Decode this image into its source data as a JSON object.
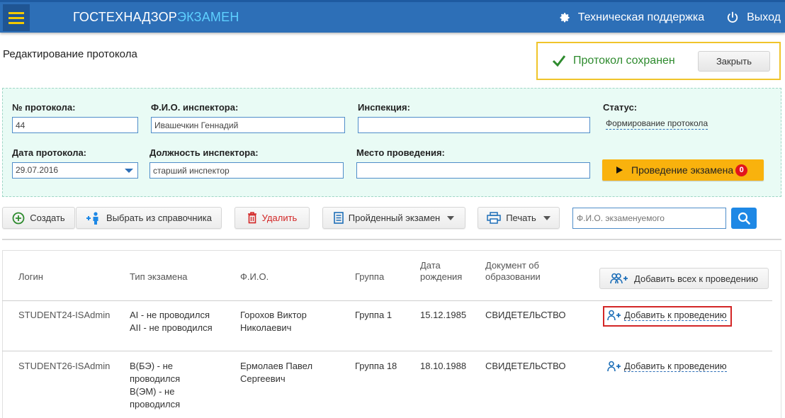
{
  "header": {
    "brand_main": "ГОСТЕХНАДЗОР",
    "brand_accent": "ЭКЗАМЕН",
    "support_label": "Техническая поддержка",
    "logout_label": "Выход"
  },
  "page": {
    "title": "Редактирование протокола"
  },
  "toast": {
    "message": "Протокол сохранен",
    "close_label": "Закрыть"
  },
  "form": {
    "protocol_no": {
      "label": "№ протокола:",
      "value": "44"
    },
    "inspector_name": {
      "label": "Ф.И.О. инспектора:",
      "value": "Ивашечкин Геннадий"
    },
    "inspection": {
      "label": "Инспекция:",
      "value": ""
    },
    "status": {
      "label": "Статус:",
      "value": "Формирование протокола"
    },
    "protocol_date": {
      "label": "Дата протокола:",
      "value": "29.07.2016"
    },
    "inspector_position": {
      "label": "Должность инспектора:",
      "value": "старший инспектор"
    },
    "venue": {
      "label": "Место проведения:",
      "value": ""
    },
    "exam_button": {
      "label": "Проведение экзамена",
      "badge": "0"
    }
  },
  "toolbar": {
    "create": "Создать",
    "choose": "Выбрать из справочника",
    "delete": "Удалить",
    "passed_exam": "Пройденный экзамен",
    "print": "Печать",
    "search_placeholder": "Ф.И.О. экзаменуемого"
  },
  "table": {
    "headers": {
      "login": "Логин",
      "exam_type": "Тип экзамена",
      "fio": "Ф.И.О.",
      "group": "Группа",
      "birth_date_1": "Дата",
      "birth_date_2": "рождения",
      "education_1": "Документ об",
      "education_2": "образовании"
    },
    "add_all_label": "Добавить всех к проведению",
    "rows": [
      {
        "login": "STUDENT24-ISAdmin",
        "exam_lines": [
          "AI - не проводился",
          "AII - не проводился"
        ],
        "fio_lines": [
          "Горохов Виктор",
          "Николаевич"
        ],
        "group": "Группа 1",
        "birth_date": "15.12.1985",
        "education": "СВИДЕТЕЛЬСТВО",
        "action": "Добавить к проведению"
      },
      {
        "login": "STUDENT26-ISAdmin",
        "exam_lines": [
          "В(БЭ) - не",
          "проводился",
          "В(ЭМ) - не",
          "проводился"
        ],
        "fio_lines": [
          "Ермолаев Павел",
          "Сергеевич"
        ],
        "group": "Группа 18",
        "birth_date": "18.10.1988",
        "education": "СВИДЕТЕЛЬСТВО",
        "action": "Добавить к проведению"
      }
    ]
  },
  "colors": {
    "header_bg": "#2d6fb7",
    "brand_accent": "#5ed0ff",
    "success": "#2e8b2e",
    "exam_button": "#f9b20d",
    "danger": "#d32626"
  },
  "icons": {
    "menu": "hamburger-icon",
    "support": "gear-icon",
    "logout": "power-icon",
    "toast": "check-icon",
    "create": "plus-circle-icon",
    "choose": "person-add-icon",
    "delete": "trash-icon",
    "passed_exam": "list-icon",
    "print": "printer-icon",
    "search": "search-icon",
    "add_all": "group-add-icon",
    "add_user": "user-add-icon"
  }
}
